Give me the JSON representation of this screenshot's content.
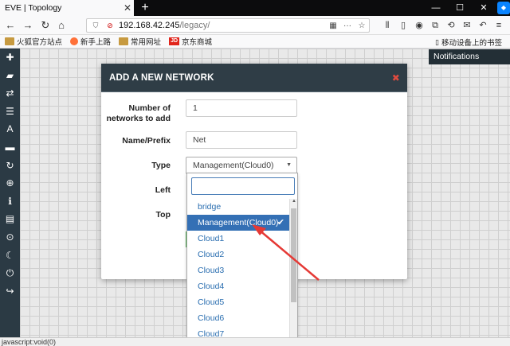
{
  "browser": {
    "tab_title": "EVE | Topology",
    "tab_close": "✕",
    "new_tab": "+",
    "url_host": "192.168.42.245",
    "url_path": "/legacy/",
    "win_min": "—",
    "win_max": "☐",
    "win_close": "✕",
    "bookmarks": [
      {
        "label": "火狐官方站点",
        "icon": "folder-icon"
      },
      {
        "label": "新手上路",
        "icon": "firefox-icon"
      },
      {
        "label": "常用网址",
        "icon": "folder-icon"
      },
      {
        "label": "京东商城",
        "icon": "jd-icon",
        "icon_text": "JD"
      }
    ],
    "mobile_bookmarks": "移动设备上的书签",
    "status_text": "javascript:void(0)"
  },
  "app": {
    "notifications_label": "Notifications"
  },
  "modal": {
    "title": "ADD A NEW NETWORK",
    "close": "✖",
    "fields": {
      "count_label": "Number of networks to add",
      "count_value": "1",
      "prefix_label": "Name/Prefix",
      "prefix_value": "Net",
      "type_label": "Type",
      "type_value": "Management(Cloud0)",
      "left_label": "Left",
      "top_label": "Top"
    }
  },
  "dropdown": {
    "options": [
      "bridge",
      "Management(Cloud0)",
      "Cloud1",
      "Cloud2",
      "Cloud3",
      "Cloud4",
      "Cloud5",
      "Cloud6",
      "Cloud7"
    ],
    "selected": "Management(Cloud0)",
    "check": "✔"
  },
  "colors": {
    "sidebar": "#2b3a44",
    "modal_header": "#2f3d46",
    "selected_option": "#3470b5",
    "option_text": "#2a6eb0",
    "annotation_arrow": "#e53935"
  }
}
